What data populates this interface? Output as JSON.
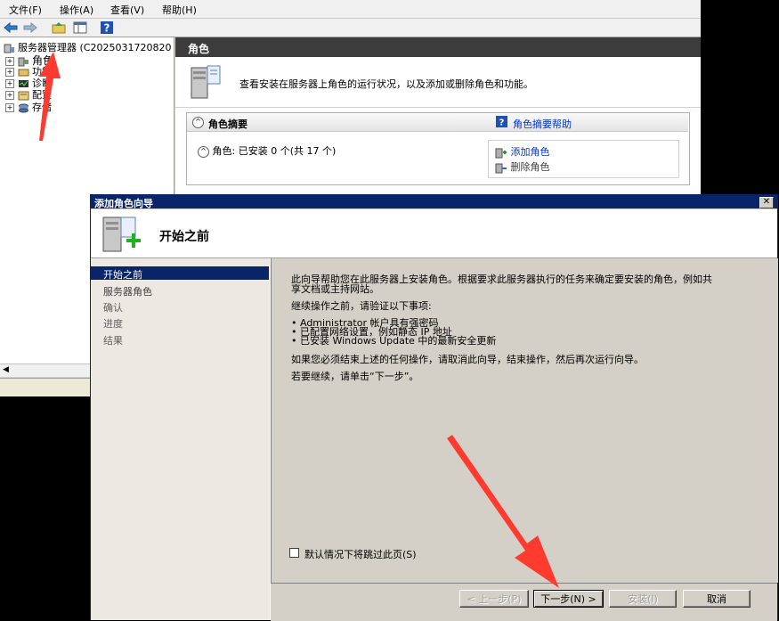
{
  "menubar": {
    "items": [
      "文件(F)",
      "操作(A)",
      "查看(V)",
      "帮助(H)"
    ]
  },
  "tree": {
    "root_label": "服务器管理器 (C2025031720820",
    "items": [
      "角色",
      "功能",
      "诊断",
      "配置",
      "存储"
    ]
  },
  "right_pane": {
    "title": "角色",
    "description": "查看安装在服务器上角色的运行状况，以及添加或删除角色和功能。",
    "summary_title": "角色摘要",
    "summary_help": "角色摘要帮助",
    "roles_status": "角色: 已安装 0 个(共 17 个)",
    "add_role": "添加角色",
    "remove_role": "删除角色"
  },
  "wizard": {
    "title": "添加角色向导",
    "header": "开始之前",
    "nav": [
      "开始之前",
      "服务器角色",
      "确认",
      "进度",
      "结果"
    ],
    "selected_nav": 0,
    "content": {
      "intro_line1": "此向导帮助您在此服务器上安装角色。根据要求此服务器执行的任务来确定要安装的角色，例如共",
      "intro_line2": "享文档或主持网站。",
      "verify": "继续操作之前，请验证以下事项:",
      "bullets": [
        "• Administrator 帐户具有强密码",
        "• 已配置网络设置，例如静态 IP 地址",
        "• 已安装 Windows Update 中的最新安全更新"
      ],
      "cancel_note": "如果您必须结束上述的任何操作，请取消此向导，结束操作，然后再次运行向导。",
      "continue_note": "若要继续，请单击“下一步”。"
    },
    "skip_label": "默认情况下将跳过此页(S)",
    "buttons": {
      "prev": "< 上一步(P)",
      "next": "下一步(N) >",
      "install": "安装(I)",
      "cancel": "取消"
    },
    "close_glyph": "✕"
  },
  "colors": {
    "title_bar": "#0a246a",
    "annotation_arrow": "#ff3b30",
    "link": "#0033cc"
  }
}
